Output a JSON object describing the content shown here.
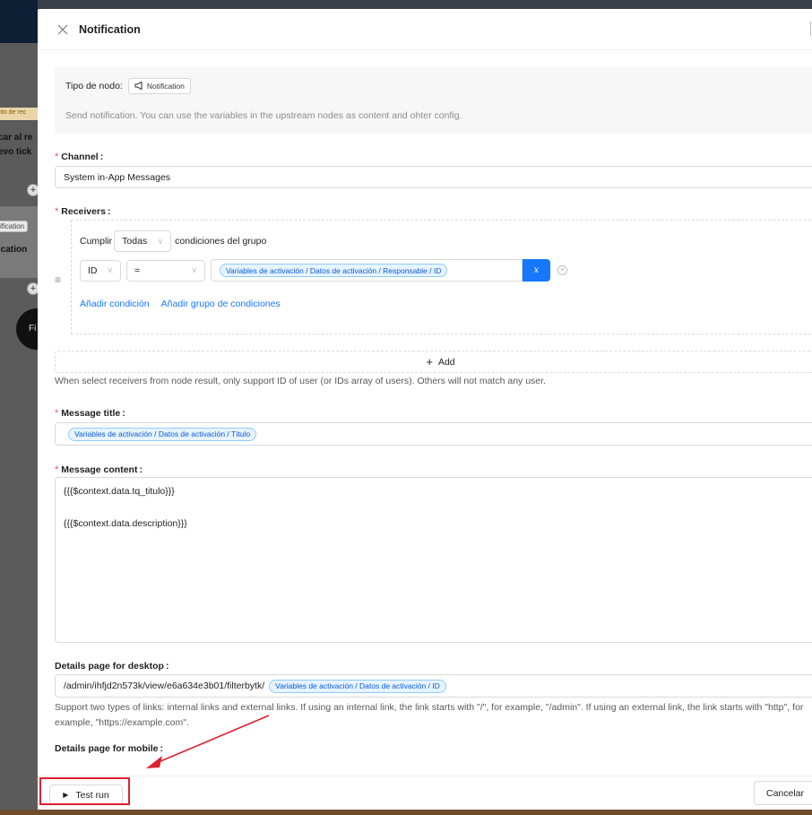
{
  "background": {
    "fragments": [
      "car al re",
      "evo tick",
      "ication"
    ],
    "chip": "ification",
    "orange_text": "nto de rec",
    "circle_text": "Fi"
  },
  "drawer": {
    "title": "Notification",
    "close_icon": "close-icon"
  },
  "info": {
    "node_type_label": "Tipo de nodo:",
    "node_type_value": "Notification",
    "node_type_icon": "megaphone-icon",
    "description": "Send notification. You can use the variables in the upstream nodes as content and ohter config."
  },
  "channel": {
    "label": "Channel",
    "value": "System in-App Messages"
  },
  "receivers": {
    "label": "Receivers",
    "cumplir": "Cumplir",
    "match_value": "Todas",
    "condition_suffix": "condiciones del grupo",
    "field_value": "ID",
    "operator_value": "=",
    "variable_tag": "Variables de activación / Datos de activación / Responsable / ID",
    "var_button": "x",
    "add_condition": "Añadir condición",
    "add_group": "Añadir grupo de condiciones",
    "add_button": "Add",
    "hint": "When select receivers from node result, only support ID of user (or IDs array of users). Others will not match any user."
  },
  "message_title": {
    "label": "Message title",
    "variable_tag": "Variables de activación / Datos de activación / Título"
  },
  "message_content": {
    "label": "Message content",
    "line1": "{{{$context.data.tq_titulo}}}",
    "line2": "{{{$context.data.description}}}"
  },
  "details_desktop": {
    "label": "Details page for desktop",
    "path": "/admin/ihfjd2n573k/view/e6a634e3b01/filterbytk/",
    "variable_tag": "Variables de activación / Datos de activación / ID",
    "hint_line1": "Support two types of links: internal links and external links. If using an internal link, the link starts with \"/\", for example, \"/admin\". If using an external link, the link starts with \"http\", for",
    "hint_line2": "example, \"https://example.com\"."
  },
  "details_mobile": {
    "label": "Details page for mobile"
  },
  "footer": {
    "test_run": "Test run",
    "cancel": "Cancelar"
  },
  "colors": {
    "primary": "#1677ff",
    "required": "#ff4d4f",
    "annotation": "#e0202f"
  }
}
